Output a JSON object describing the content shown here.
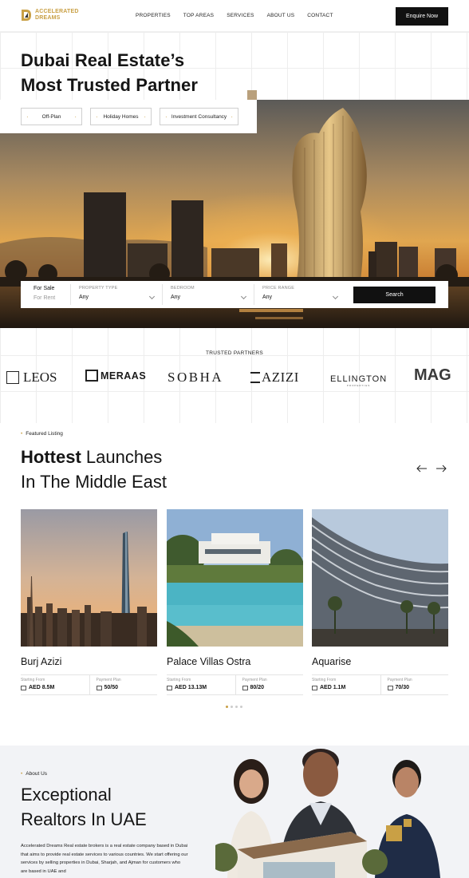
{
  "nav": {
    "logo_line1": "ACCELERATED",
    "logo_line2": "DREAMS",
    "links": [
      "PROPERTIES",
      "TOP AREAS",
      "SERVICES",
      "ABOUT US",
      "CONTACT"
    ],
    "cta": "Enquire Now"
  },
  "hero": {
    "title_line1": "Dubai Real Estate’s",
    "title_line2": "Most Trusted Partner",
    "chips": [
      "Off-Plan",
      "Holiday Homes",
      "Investment Consultancy"
    ]
  },
  "search": {
    "mode_active": "For Sale",
    "mode_inactive": "For Rent",
    "fields": [
      {
        "label": "PROPERTY TYPE",
        "value": "Any"
      },
      {
        "label": "BEDROOM",
        "value": "Any"
      },
      {
        "label": "PRICE RANGE",
        "value": "Any"
      }
    ],
    "button": "Search"
  },
  "partners": {
    "title": "TRUSTED PARTNERS",
    "logos": [
      "LEOS",
      "MERAAS",
      "SOBHA",
      "AZIZI",
      "ELLINGTON",
      "MAG"
    ],
    "ellington_sub": "PROPERTIES"
  },
  "featured": {
    "eyebrow": "Featured Listing",
    "title_bold": "Hottest",
    "title_rest": " Launches",
    "title_line2": "In The Middle East",
    "starting_label": "Starting From",
    "plan_label": "Payment Plan",
    "cards": [
      {
        "name": "Burj Azizi",
        "price": "AED 8.5M",
        "plan": "50/50"
      },
      {
        "name": "Palace Villas Ostra",
        "price": "AED 13.13M",
        "plan": "80/20"
      },
      {
        "name": "Aquarise",
        "price": "AED 1.1M",
        "plan": "70/30"
      }
    ]
  },
  "about": {
    "eyebrow": "About Us",
    "title_line1": "Exceptional",
    "title_line2": "Realtors In UAE",
    "desc": "Accelerated Dreams Real estate brokers is a real estate company based in Dubai that aims to provide real estate services to various countries. We start offering our services by selling properties in Dubai, Sharjah, and Ajman for customers who are based in UAE and"
  },
  "colors": {
    "accent": "#c9a045",
    "dark": "#111111"
  }
}
